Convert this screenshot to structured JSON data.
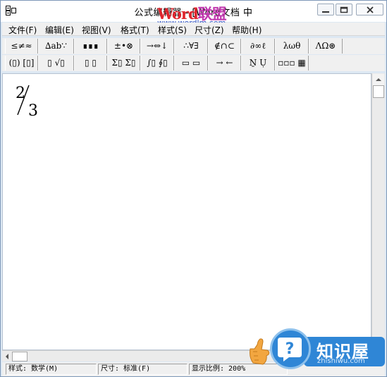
{
  "window": {
    "title": "公式编辑器 - [Word文档 中",
    "watermark_logo": [
      "Word",
      "联盟"
    ],
    "watermark_url": "www.wordlm.com"
  },
  "menu": [
    "文件(F)",
    "编辑(E)",
    "视图(V)",
    "格式(T)",
    "样式(S)",
    "尺寸(Z)",
    "帮助(H)"
  ],
  "toolbar1": [
    "≤≠≈",
    "∆ab∵",
    "∎∎∎",
    "±•⊗",
    "→⇔↓",
    "∴∀∃",
    "∉∩⊂",
    "∂∞ℓ",
    "λωθ",
    "ΛΩ⊛"
  ],
  "toolbar2": [
    "(▯) [▯]",
    "▯ √▯",
    "▯ ▯",
    "Σ▯ Σ▯",
    "∫▯ ∮▯",
    "▭ ▭",
    "→ ←",
    "Ṉ Ụ",
    "▫▫▫ ▦"
  ],
  "document": {
    "formula": {
      "numerator": "2",
      "denominator": "3"
    }
  },
  "status": {
    "style": "样式: 数学(M)",
    "size": "尺寸: 标准(F)",
    "zoom": "显示比例: 200%"
  },
  "badge": {
    "name": "知识屋",
    "url": "zhishiwu.com",
    "icon": "question-mark-icon",
    "colors": {
      "primary": "#2f86d6",
      "hand": "#f2a640"
    }
  }
}
